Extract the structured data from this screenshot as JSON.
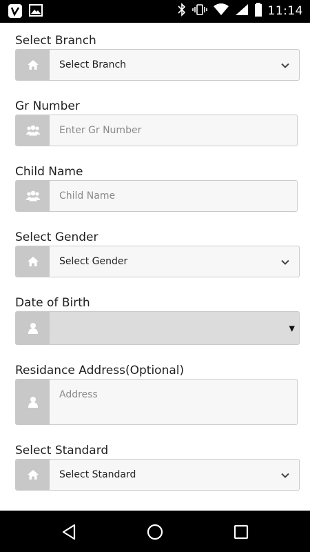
{
  "status_bar": {
    "time": "11:14",
    "left_icons": [
      "vine-app-icon",
      "image-icon"
    ],
    "right_icons": [
      "bluetooth-icon",
      "vibrate-icon",
      "wifi-icon",
      "signal-icon",
      "battery-icon"
    ]
  },
  "form": {
    "branch": {
      "label": "Select Branch",
      "value": "Select Branch",
      "icon": "home-icon"
    },
    "gr_number": {
      "label": "Gr Number",
      "placeholder": "Enter Gr Number",
      "icon": "users-icon"
    },
    "child_name": {
      "label": "Child Name",
      "placeholder": "Child Name",
      "icon": "users-icon"
    },
    "gender": {
      "label": "Select Gender",
      "value": "Select Gender",
      "icon": "home-icon"
    },
    "dob": {
      "label": "Date of Birth",
      "value": "",
      "icon": "user-icon"
    },
    "address": {
      "label": "Residance Address(Optional)",
      "placeholder": "Address",
      "icon": "user-icon"
    },
    "standard": {
      "label": "Select Standard",
      "value": "Select Standard",
      "icon": "home-icon"
    }
  },
  "nav_bar": {
    "buttons": [
      "back-icon",
      "home-circle-icon",
      "recents-icon"
    ]
  },
  "colors": {
    "addon": "#c8c8c8",
    "field_bg": "#f7f7f7",
    "border": "#c9c9c9"
  }
}
